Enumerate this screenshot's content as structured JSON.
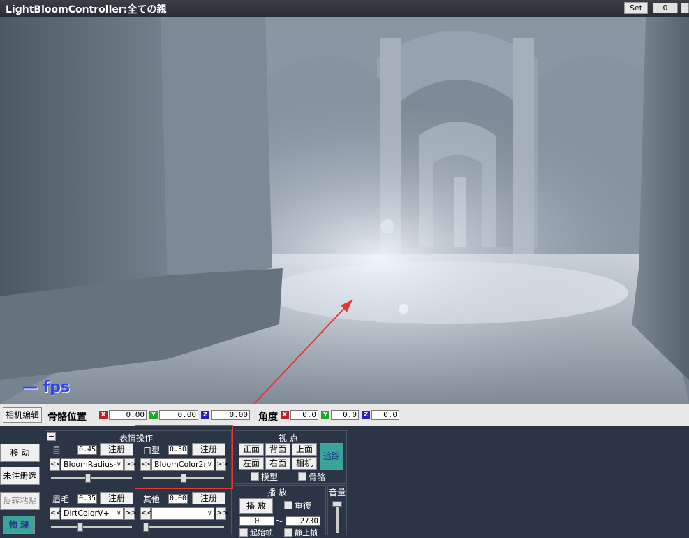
{
  "window": {
    "title": "LightBloomController:全ての親",
    "set_label": "Set",
    "set_value": "0"
  },
  "viewport": {
    "fps_label": "— fps"
  },
  "bone_bar": {
    "camera_edit_label": "相机编辑",
    "bone_position_label": "骨骼位置",
    "angle_label": "角度",
    "axis_x": "X",
    "axis_y": "Y",
    "axis_z": "Z",
    "pos_x": "0.00",
    "pos_y": "0.00",
    "pos_z": "0.00",
    "ang_x": "0.0",
    "ang_y": "0.0",
    "ang_z": "0.0"
  },
  "side_buttons": {
    "move": "移 动",
    "unregistered": "未注册选",
    "reverse_paste": "反转粘贴",
    "physics": "物 理"
  },
  "expression_panel": {
    "title": "表情操作",
    "collapse": "−",
    "eye_label": "目",
    "eye_value": "0.450",
    "mouth_label": "口型",
    "mouth_value": "0.500",
    "brow_label": "眉毛",
    "brow_value": "0.350",
    "other_label": "其他",
    "other_value": "0.000",
    "register_label": "注册",
    "eye_select": "BloomRadius-",
    "mouth_select": "BloomColor2r",
    "brow_select": "DirtColorV+",
    "other_select": "",
    "prev": "<<",
    "next": ">>",
    "eye_slider": 0.45,
    "mouth_slider": 0.5,
    "brow_slider": 0.35,
    "other_slider": 0.0
  },
  "view_panel": {
    "title": "视 点",
    "front": "正面",
    "back": "背面",
    "top": "上面",
    "left": "左面",
    "right": "右面",
    "camera": "相机",
    "track": "追踪",
    "model_check": "模型",
    "bone_check": "骨骼"
  },
  "play_panel": {
    "title": "播 放",
    "play_button": "播 放",
    "repeat_label": "重復",
    "start_frame": "0",
    "tilde": "〜",
    "end_frame": "2730",
    "start_label": "起始帧",
    "stop_label": "静止帧"
  },
  "volume_panel": {
    "title": "音量"
  },
  "colors": {
    "panel_bg": "#2b3545",
    "accent_teal": "#3aa39a",
    "annotation_red": "#e53935"
  }
}
